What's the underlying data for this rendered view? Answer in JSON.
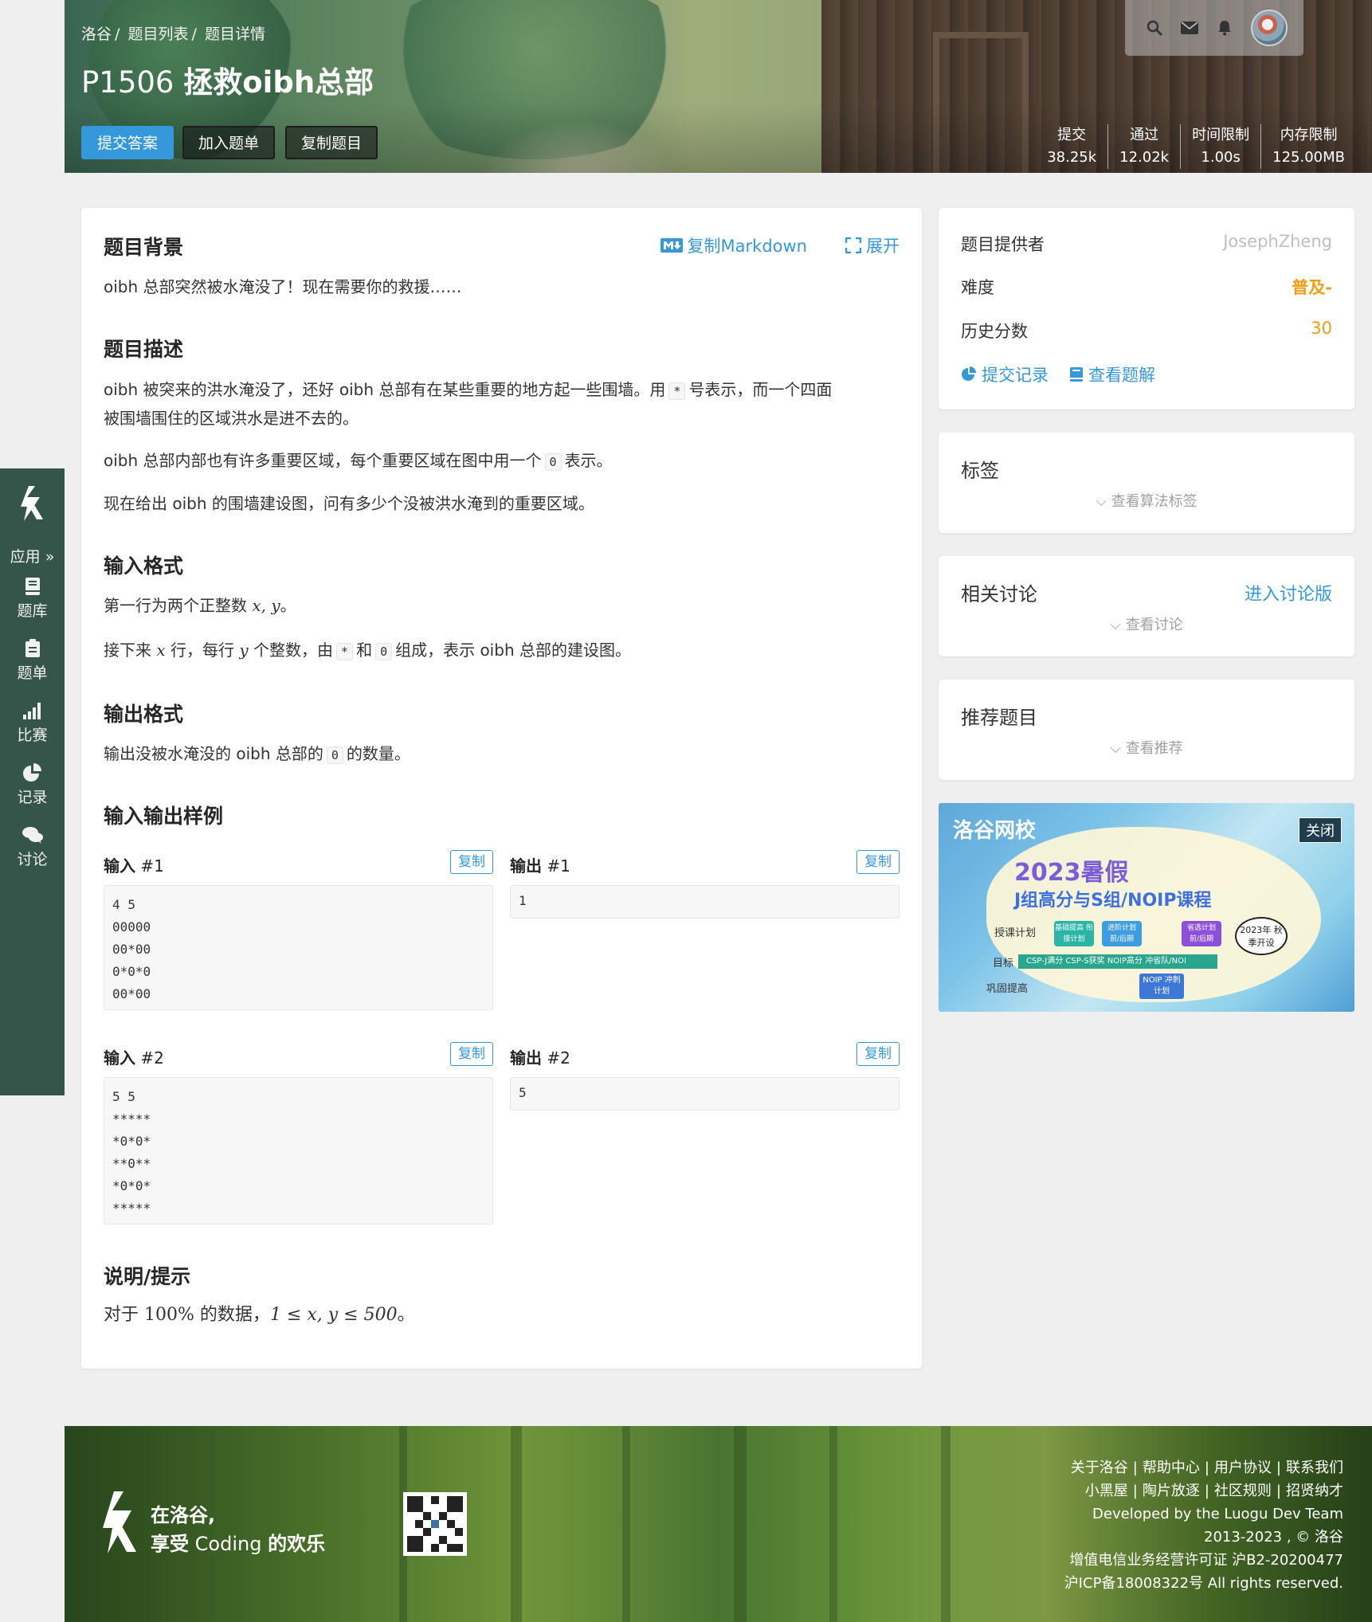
{
  "header": {
    "breadcrumb": [
      "洛谷",
      "/",
      "题目列表",
      "/",
      "题目详情"
    ],
    "pid": "P1506",
    "title": "拯救oibh总部",
    "buttons": {
      "submit": "提交答案",
      "add_list": "加入题单",
      "copy": "复制题目"
    },
    "stats": [
      {
        "label": "提交",
        "value": "38.25k"
      },
      {
        "label": "通过",
        "value": "12.02k"
      },
      {
        "label": "时间限制",
        "value": "1.00s"
      },
      {
        "label": "内存限制",
        "value": "125.00MB"
      }
    ],
    "icons": [
      "search-icon",
      "envelope-icon",
      "bell-icon"
    ]
  },
  "sidebar": {
    "apps_label": "应用 »",
    "items": [
      {
        "label": "题库",
        "icon": "book-icon"
      },
      {
        "label": "题单",
        "icon": "clipboard-icon"
      },
      {
        "label": "比赛",
        "icon": "bar-chart-icon"
      },
      {
        "label": "记录",
        "icon": "pie-chart-icon"
      },
      {
        "label": "讨论",
        "icon": "comments-icon"
      }
    ]
  },
  "problem": {
    "copy_markdown": "复制Markdown",
    "expand": "展开",
    "background_title": "题目背景",
    "background_text": "oibh 总部突然被水淹没了！现在需要你的救援……",
    "description_title": "题目描述",
    "desc_p1_a": "oibh 被突来的洪水淹没了，还好 oibh 总部有在某些重要的地方起一些围墙。用",
    "desc_p1_code": "*",
    "desc_p1_b": "号表示，而一个四面",
    "desc_p1_c": "被围墙围住的区域洪水是进不去的。",
    "desc_p2_a": "oibh 总部内部也有许多重要区域，每个重要区域在图中用一个",
    "desc_p2_code": "0",
    "desc_p2_b": "表示。",
    "desc_p3": "现在给出 oibh 的围墙建设图，问有多少个没被洪水淹到的重要区域。",
    "input_title": "输入格式",
    "input_p1_a": "第一行为两个正整数",
    "input_p1_math": "x, y",
    "input_p1_b": "。",
    "input_p2_a": "接下来",
    "input_p2_x": "x",
    "input_p2_b": "行，每行",
    "input_p2_y": "y",
    "input_p2_c": "个整数，由",
    "input_p2_code1": "*",
    "input_p2_d": "和",
    "input_p2_code2": "0",
    "input_p2_e": "组成，表示 oibh 总部的建设图。",
    "output_title": "输出格式",
    "output_a": "输出没被水淹没的 oibh 总部的",
    "output_code": "0",
    "output_b": "的数量。",
    "samples_title": "输入输出样例",
    "copy_label": "复制",
    "input_label": "输入",
    "output_label": "输出",
    "sample1_num": "#1",
    "sample1_in": "4 5\n00000\n00*00\n0*0*0\n00*00",
    "sample1_out": "1",
    "sample2_num": "#2",
    "sample2_in": "5 5\n*****\n*0*0*\n**0**\n*0*0*\n*****",
    "sample2_out": "5",
    "hint_title": "说明/提示",
    "hint_a": "对于",
    "hint_pct": "100%",
    "hint_b": "的数据，",
    "hint_math": "1 ≤ x, y ≤ 500",
    "hint_c": "。"
  },
  "info": {
    "provider_label": "题目提供者",
    "provider_value": "JosephZheng",
    "difficulty_label": "难度",
    "difficulty_value": "普及-",
    "history_label": "历史分数",
    "history_value": "30",
    "records_link": "提交记录",
    "solutions_link": "查看题解",
    "colors": {
      "accent": "#3498db",
      "difficulty": "#f39c11",
      "provider": "#bfbfbf"
    }
  },
  "tags": {
    "title": "标签",
    "more": "查看算法标签"
  },
  "discuss": {
    "title": "相关讨论",
    "link": "进入讨论版",
    "more": "查看讨论"
  },
  "recommend": {
    "title": "推荐题目",
    "more": "查看推荐"
  },
  "ad": {
    "brand": "洛谷网校",
    "close": "关闭",
    "line1": "2023暑假",
    "line2": "J组高分与S组/NOIP课程",
    "plan_label": "授课计划",
    "chips": [
      "基础提高 衔接计划",
      "进阶计划 前/后期",
      "省选计划 前/后期"
    ],
    "goal_label": "目标",
    "goal_bar": "CSP-J满分  CSP-S获奖  NOIP高分  冲省队/NOI",
    "season": "2023年 秋季开设",
    "consolidate": "巩固提高",
    "noip_chip": "NOIP 冲刺计划"
  },
  "footer": {
    "slogan1": "在洛谷,",
    "slogan2_a": "享受",
    "slogan2_b": "Coding",
    "slogan2_c": "的欢乐",
    "links_row1": [
      "关于洛谷",
      "帮助中心",
      "用户协议",
      "联系我们"
    ],
    "links_row2": [
      "小黑屋",
      "陶片放逐",
      "社区规则",
      "招贤纳才"
    ],
    "dev": "Developed by the Luogu Dev Team",
    "copyright": "2013-2023 , © 洛谷",
    "license": "增值电信业务经营许可证 沪B2-20200477",
    "icp": "沪ICP备18008322号 All rights reserved."
  }
}
